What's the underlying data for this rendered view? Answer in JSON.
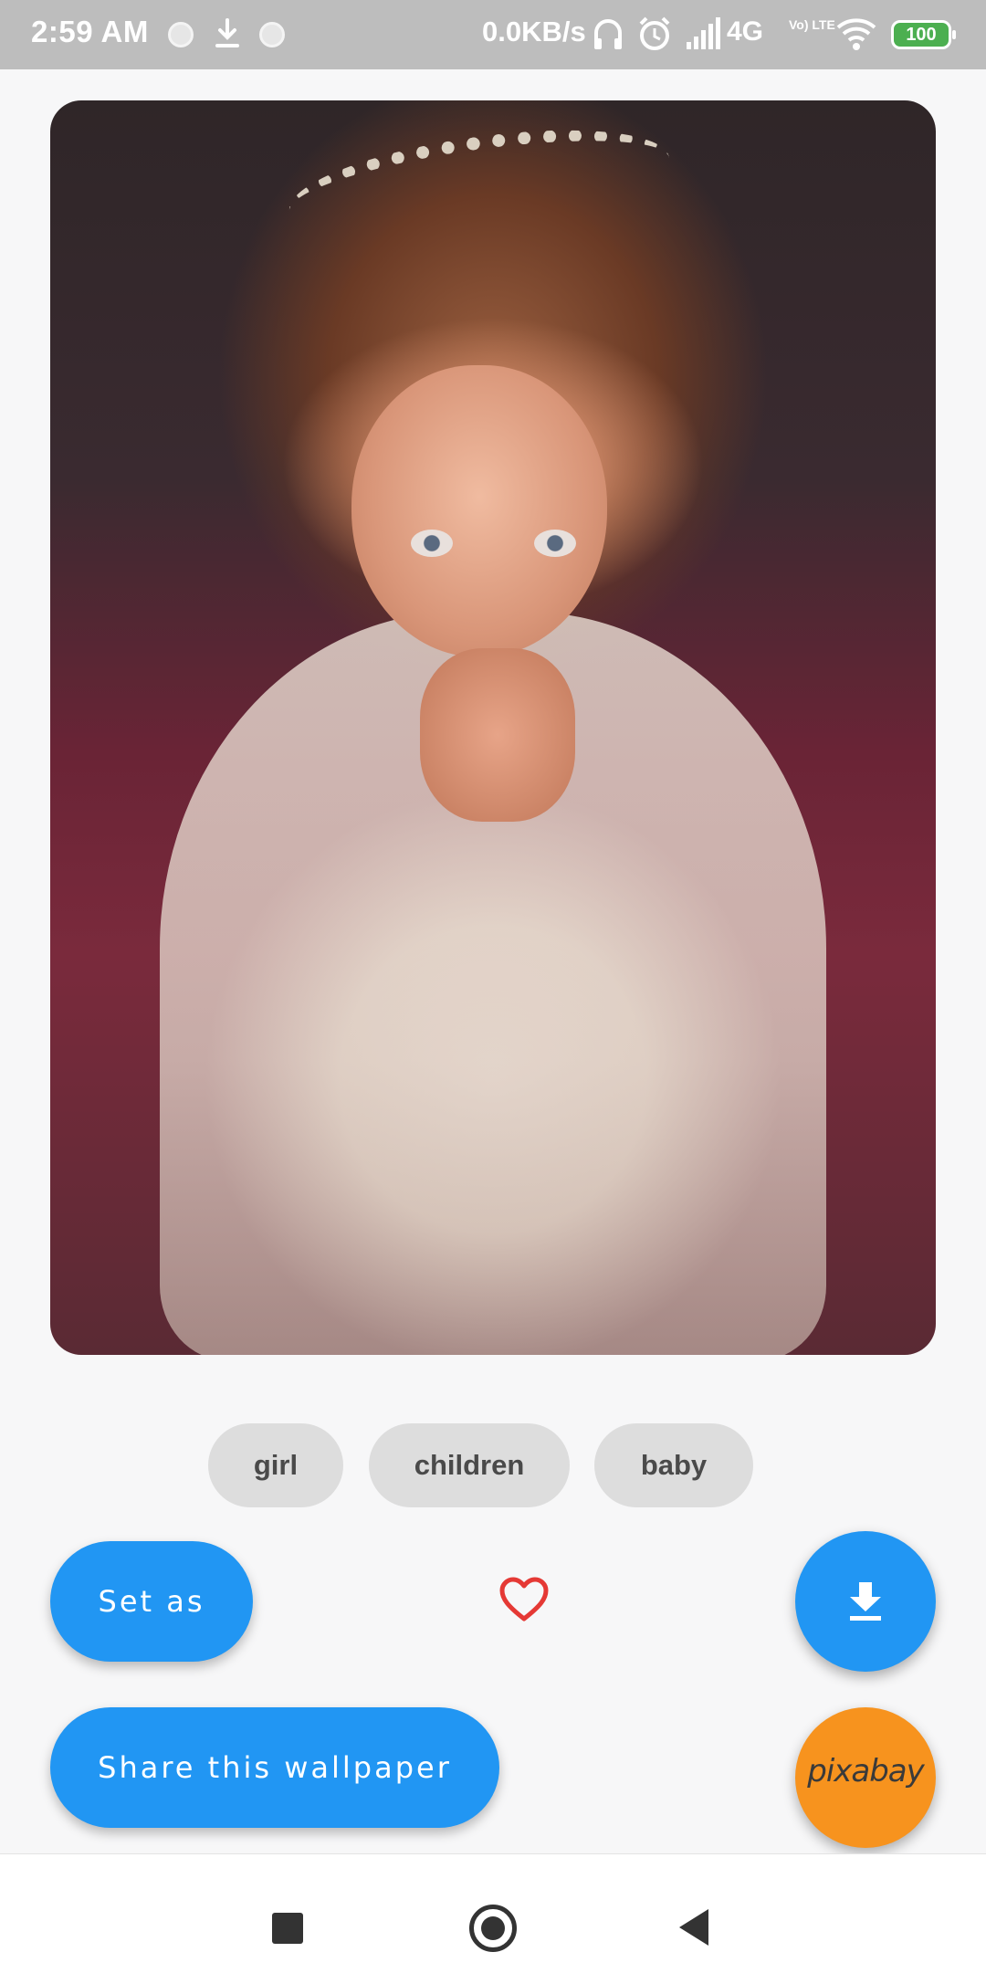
{
  "status_bar": {
    "time": "2:59 AM",
    "net_speed": "0.0KB/s",
    "network": "4G",
    "volte": "Vo) LTE",
    "battery": "100",
    "icons": [
      "notification-dot-icon",
      "download-icon",
      "notification-dot-icon",
      "headphones-icon",
      "alarm-icon",
      "signal-icon",
      "wifi-icon",
      "battery-icon"
    ]
  },
  "wallpaper": {
    "alt": "girl children baby"
  },
  "tags": [
    "girl",
    "children",
    "baby"
  ],
  "actions": {
    "set_as_label": "Set as",
    "share_label": "Share this wallpaper",
    "favorite_icon": "heart-outline-icon",
    "download_icon": "download-icon",
    "source_label": "pixabay"
  },
  "colors": {
    "accent": "#2196f3",
    "favorite": "#e53935",
    "pixabay": "#f7931e",
    "tag_bg": "#dddddd",
    "battery": "#4caf50"
  },
  "nav_bar": {
    "icons": [
      "recents-square-icon",
      "home-circle-icon",
      "back-triangle-icon"
    ]
  }
}
